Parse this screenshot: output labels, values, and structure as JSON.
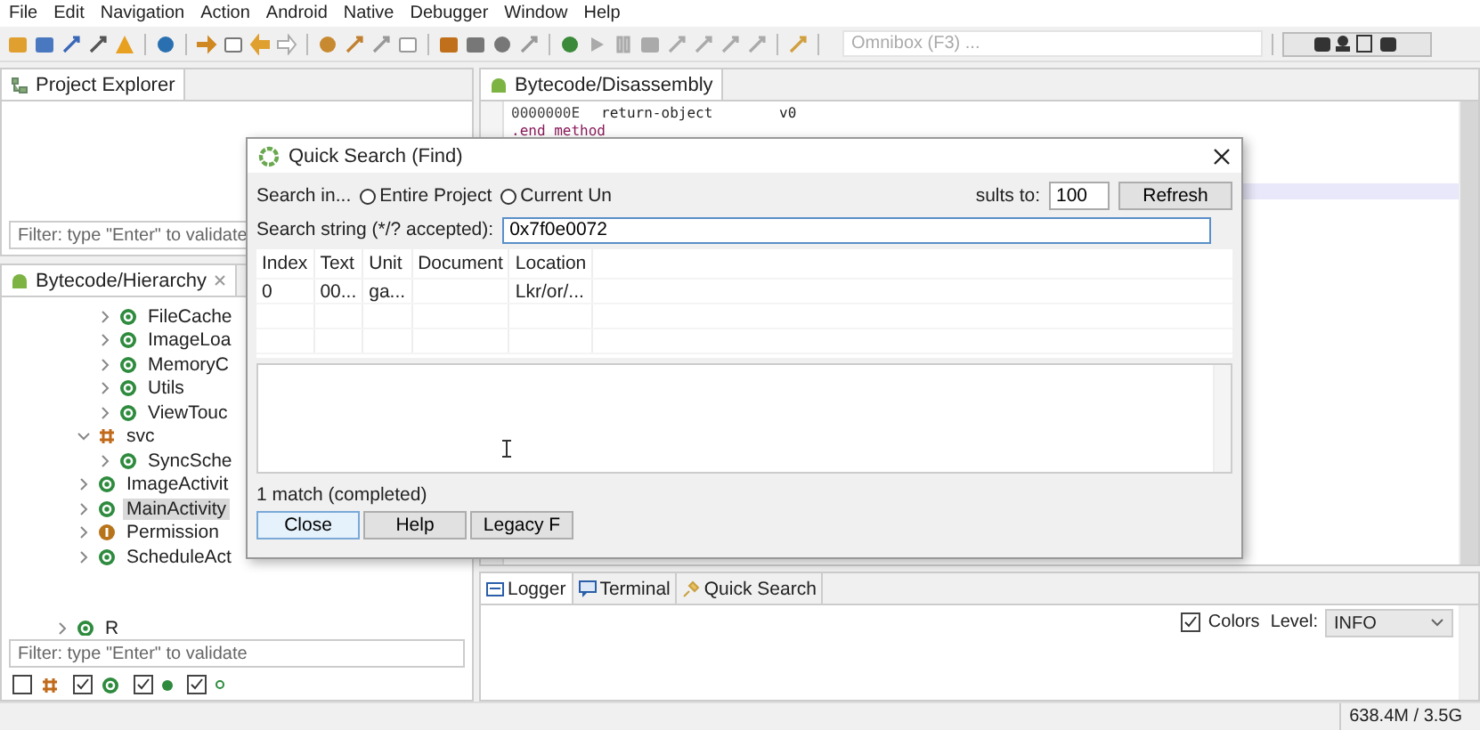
{
  "menu": [
    "File",
    "Edit",
    "Navigation",
    "Action",
    "Android",
    "Native",
    "Debugger",
    "Window",
    "Help"
  ],
  "omnibox": {
    "placeholder": "Omnibox (F3) ..."
  },
  "project_explorer": {
    "title": "Project Explorer",
    "filter": {
      "placeholder": "Filter: type \"Enter\" to validate"
    }
  },
  "hierarchy": {
    "title": "Bytecode/Hierarchy",
    "tree": [
      {
        "children": [
          {
            "children": [
              {
                "label": "FileCache",
                "kind": "class",
                "expanded": false,
                "selected": false
              },
              {
                "label": "ImageLoa",
                "kind": "class",
                "expanded": false,
                "selected": false
              },
              {
                "label": "MemoryC",
                "kind": "class",
                "expanded": false,
                "selected": false
              },
              {
                "label": "Utils",
                "kind": "class",
                "expanded": false,
                "selected": false
              },
              {
                "label": "ViewTouc",
                "kind": "class",
                "expanded": false,
                "selected": false
              }
            ]
          },
          {
            "label": "svc",
            "kind": "package",
            "expanded": true,
            "selected": false,
            "children": [
              {
                "label": "SyncSche",
                "kind": "class",
                "expanded": false,
                "selected": false
              }
            ]
          },
          {
            "label": "ImageActivit",
            "kind": "class",
            "expanded": false,
            "selected": false
          },
          {
            "label": "MainActivity",
            "kind": "class",
            "expanded": false,
            "selected": true
          },
          {
            "label": "Permission",
            "kind": "interface",
            "expanded": false,
            "selected": false
          },
          {
            "label": "ScheduleAct",
            "kind": "class",
            "expanded": false,
            "selected": false
          }
        ]
      },
      {
        "label": "R",
        "kind": "class",
        "expanded": false,
        "selected": false
      }
    ],
    "filter": {
      "placeholder": "Filter: type \"Enter\" to validate"
    },
    "toggles": [
      {
        "kind": "package",
        "checked": false
      },
      {
        "kind": "class",
        "checked": true
      },
      {
        "kind": "dot",
        "checked": true
      },
      {
        "kind": "small-dot",
        "checked": true
      }
    ]
  },
  "editor": {
    "title": "Bytecode/Disassembly",
    "lines": [
      {
        "offset": "0000000E",
        "code": "return-object",
        "operand": "v0"
      },
      {
        "code": ".end method"
      }
    ]
  },
  "dialog": {
    "title": "Quick Search (Find)",
    "search_in": "Search in...",
    "scopes": [
      {
        "label": "Entire Project",
        "selected": false
      },
      {
        "label": "Current Un",
        "selected": false
      }
    ],
    "limit_label": "sults to:",
    "limit": "100",
    "refresh": "Refresh",
    "search_label": "Search string (*/? accepted):",
    "search_value": "0x7f0e0072",
    "table": {
      "columns": [
        "Index",
        "Text",
        "Unit",
        "Document",
        "Location"
      ],
      "rows": [
        [
          "0",
          "00...",
          "ga...",
          null,
          "Lkr/or/..."
        ]
      ]
    },
    "status": "1 match (completed)",
    "buttons": [
      "Close",
      "Help",
      "Legacy F"
    ]
  },
  "bottom_panel": {
    "tabs": [
      {
        "label": "Logger",
        "kind": "logger",
        "selected": true
      },
      {
        "label": "Terminal",
        "kind": "terminal",
        "selected": false
      },
      {
        "label": "Quick Search",
        "kind": "search",
        "selected": false
      }
    ],
    "colors": {
      "label": "Colors",
      "checked": true
    },
    "level": {
      "label": "Level:",
      "value": "INFO"
    }
  },
  "status_bar": {
    "memory": "638.4M / 3.5G"
  }
}
